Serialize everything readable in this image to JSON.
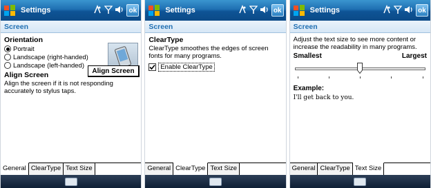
{
  "screens": [
    {
      "title": "Settings",
      "ok": "ok",
      "header": "Screen",
      "orientation": {
        "title": "Orientation",
        "options": [
          "Portrait",
          "Landscape (right-handed)",
          "Landscape (left-handed)"
        ],
        "selected": 0
      },
      "align": {
        "title": "Align Screen",
        "text": "Align the screen if it is not responding accurately to stylus taps.",
        "button": "Align Screen"
      },
      "tabs": [
        "General",
        "ClearType",
        "Text Size"
      ],
      "active_tab": 0
    },
    {
      "title": "Settings",
      "ok": "ok",
      "header": "Screen",
      "cleartype": {
        "title": "ClearType",
        "text": "ClearType smoothes the edges of screen fonts for many programs.",
        "checkbox": "Enable ClearType",
        "checked": true
      },
      "tabs": [
        "General",
        "ClearType",
        "Text Size"
      ],
      "active_tab": 1
    },
    {
      "title": "Settings",
      "ok": "ok",
      "header": "Screen",
      "textsize": {
        "text": "Adjust the text size to see more content or increase the readability in many programs.",
        "min_label": "Smallest",
        "max_label": "Largest",
        "position": 0.5,
        "ticks": 5,
        "example_label": "Example:",
        "example_text": "I'll get back to you."
      },
      "tabs": [
        "General",
        "ClearType",
        "Text Size"
      ],
      "active_tab": 2
    }
  ],
  "icons": {
    "start": "windows-flag-icon",
    "connectivity": "connectivity-icon",
    "signal": "signal-icon",
    "volume": "volume-icon",
    "keyboard": "keyboard-icon"
  }
}
